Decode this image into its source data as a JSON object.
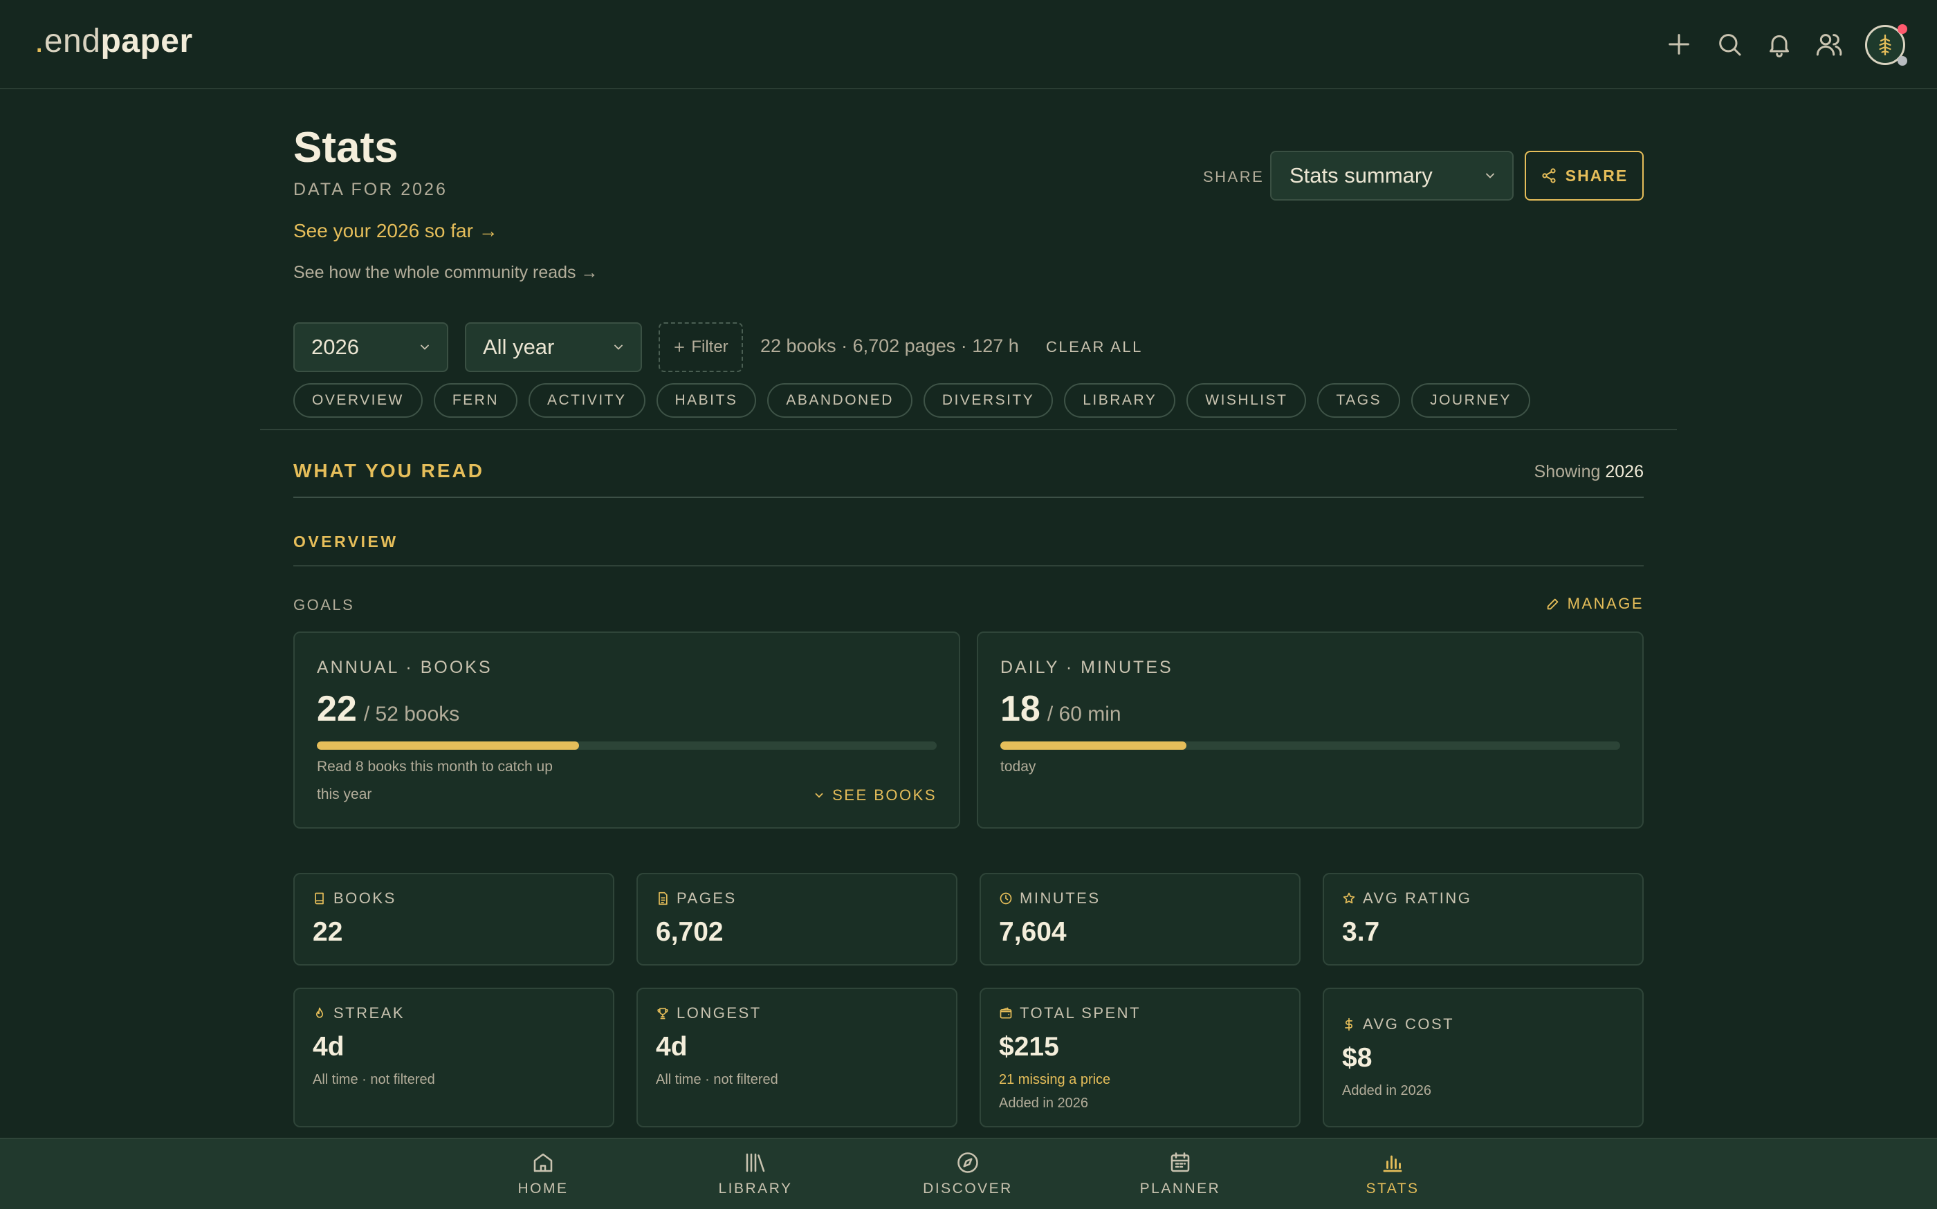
{
  "brand": {
    "dot": ".",
    "end": "end",
    "paper": "paper"
  },
  "header": {
    "title": "Stats",
    "subtitle": "DATA FOR 2026",
    "year_link": "See your 2026 so far →",
    "community_link": "See how the whole community reads →",
    "share_label": "SHARE",
    "share_select_value": "Stats summary",
    "share_button": "SHARE"
  },
  "filters": {
    "year": "2026",
    "period": "All year",
    "filter_button": "Filter",
    "summary": "22 books · 6,702 pages · 127 h",
    "clear_all": "CLEAR ALL"
  },
  "tabs": [
    "OVERVIEW",
    "FERN",
    "ACTIVITY",
    "HABITS",
    "ABANDONED",
    "DIVERSITY",
    "LIBRARY",
    "WISHLIST",
    "TAGS",
    "JOURNEY"
  ],
  "section": {
    "title": "WHAT YOU READ",
    "showing_label": "Showing",
    "showing_value": "2026",
    "subsection": "OVERVIEW",
    "goals_label": "GOALS",
    "manage": "MANAGE"
  },
  "goals": [
    {
      "title": "ANNUAL · BOOKS",
      "value": "22",
      "target": "/ 52 books",
      "progress": 0.423,
      "note1": "Read 8 books this month to catch up",
      "note2": "this year",
      "action": "SEE BOOKS"
    },
    {
      "title": "DAILY · MINUTES",
      "value": "18",
      "target": "/ 60 min",
      "progress": 0.3,
      "note1": "today"
    }
  ],
  "stats": [
    {
      "label": "BOOKS",
      "icon": "book-icon",
      "value": "22"
    },
    {
      "label": "PAGES",
      "icon": "page-icon",
      "value": "6,702"
    },
    {
      "label": "MINUTES",
      "icon": "clock-icon",
      "value": "7,604"
    },
    {
      "label": "AVG RATING",
      "icon": "star-icon",
      "value": "3.7"
    },
    {
      "label": "STREAK",
      "icon": "flame-icon",
      "value": "4d",
      "note": "All time · not filtered"
    },
    {
      "label": "LONGEST",
      "icon": "trophy-icon",
      "value": "4d",
      "note": "All time · not filtered"
    },
    {
      "label": "TOTAL SPENT",
      "icon": "wallet-icon",
      "value": "$215",
      "warn": "21 missing a price",
      "note": "Added in 2026"
    },
    {
      "label": "AVG COST",
      "icon": "dollar-icon",
      "value": "$8",
      "note": "Added in 2026"
    }
  ],
  "nav": [
    {
      "label": "HOME",
      "icon": "home-icon"
    },
    {
      "label": "LIBRARY",
      "icon": "library-icon"
    },
    {
      "label": "DISCOVER",
      "icon": "compass-icon"
    },
    {
      "label": "PLANNER",
      "icon": "calendar-icon"
    },
    {
      "label": "STATS",
      "icon": "bar-chart-icon"
    }
  ],
  "colors": {
    "background": "#15271f",
    "accent": "#e6be5a",
    "card": "#1a2f25",
    "notification": "#ff5a6e"
  }
}
